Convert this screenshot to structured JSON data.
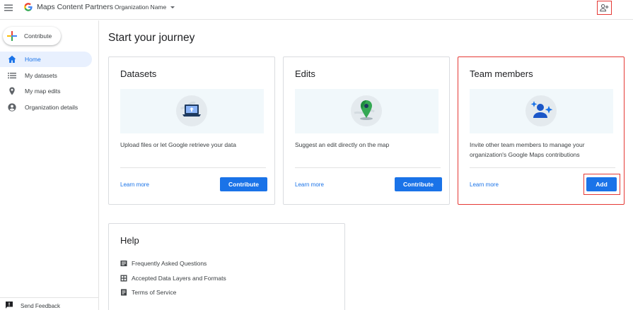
{
  "header": {
    "app_title": "Maps Content Partners",
    "org_selector": "Organization Name"
  },
  "sidebar": {
    "contribute_label": "Contribute",
    "items": [
      {
        "label": "Home",
        "icon": "home-icon",
        "active": true
      },
      {
        "label": "My datasets",
        "icon": "list-icon",
        "active": false
      },
      {
        "label": "My map edits",
        "icon": "map-pin-icon",
        "active": false
      },
      {
        "label": "Organization details",
        "icon": "account-circle-icon",
        "active": false
      }
    ],
    "feedback_label": "Send Feedback"
  },
  "main": {
    "title": "Start your journey",
    "cards": [
      {
        "title": "Datasets",
        "description": "Upload files or let Google retrieve your data",
        "learn_more": "Learn more",
        "button": "Contribute",
        "icon": "laptop-upload-icon"
      },
      {
        "title": "Edits",
        "description": "Suggest an edit directly on the map",
        "learn_more": "Learn more",
        "button": "Contribute",
        "icon": "map-pin-globe-icon"
      },
      {
        "title": "Team members",
        "description": "Invite other team members to manage your organization's Google Maps contributions",
        "learn_more": "Learn more",
        "button": "Add",
        "icon": "team-sparkle-icon"
      }
    ],
    "help": {
      "title": "Help",
      "items": [
        {
          "label": "Frequently Asked Questions",
          "icon": "book-icon"
        },
        {
          "label": "Accepted Data Layers and Formats",
          "icon": "grid-icon"
        },
        {
          "label": "Terms of Service",
          "icon": "document-icon"
        }
      ]
    }
  },
  "colors": {
    "accent": "#1a73e8",
    "highlight": "#e53935",
    "active_bg": "#e8f0fe"
  }
}
